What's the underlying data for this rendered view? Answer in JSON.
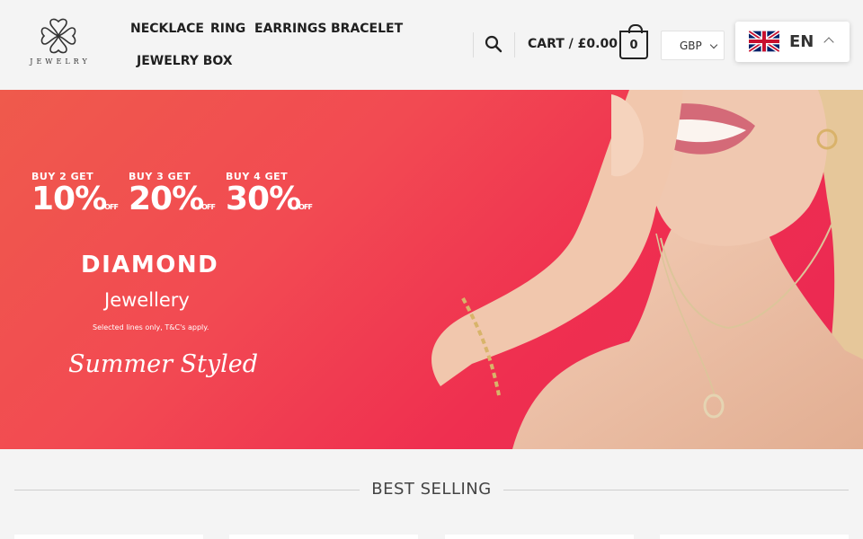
{
  "brand": {
    "logo_text": "JEWELRY"
  },
  "nav": {
    "items": [
      {
        "label": "NECKLACE"
      },
      {
        "label": "RING"
      },
      {
        "label": "EARRINGS"
      },
      {
        "label": "BRACELET"
      },
      {
        "label": "JEWELRY BOX"
      }
    ]
  },
  "header": {
    "search_icon": "search-icon",
    "cart_label": "CART / £0.00",
    "cart_count": "0",
    "currency": "GBP",
    "language": "EN",
    "language_flag": "uk-flag"
  },
  "hero": {
    "offers": [
      {
        "top": "BUY 2 GET",
        "percent": "10%",
        "suffix": "OFF"
      },
      {
        "top": "BUY 3 GET",
        "percent": "20%",
        "suffix": "OFF"
      },
      {
        "top": "BUY 4 GET",
        "percent": "30%",
        "suffix": "OFF"
      }
    ],
    "title": "DIAMOND",
    "subtitle": "Jewellery",
    "note": "Selected lines only, T&C's apply.",
    "script": "Summer Styled",
    "bg_color": "#ef3a50"
  },
  "best_selling": {
    "title": "BEST SELLING"
  }
}
